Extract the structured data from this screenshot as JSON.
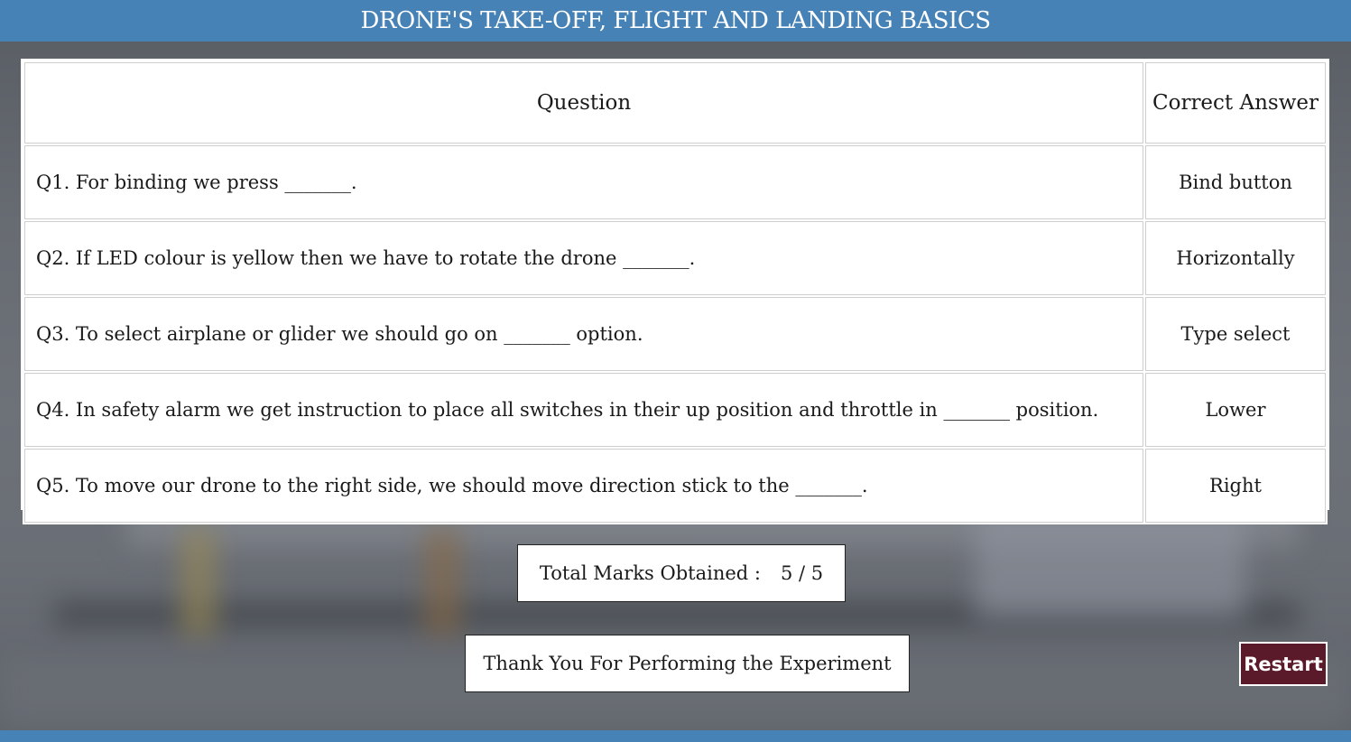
{
  "header": {
    "title": "DRONE'S TAKE-OFF, FLIGHT AND LANDING BASICS"
  },
  "table": {
    "columns": [
      "Question",
      "Correct Answer"
    ],
    "rows": [
      {
        "question": "Q1. For binding we press _______.",
        "answer": "Bind button"
      },
      {
        "question": "Q2. If LED colour is yellow then we have to rotate the drone _______.",
        "answer": "Horizontally"
      },
      {
        "question": "Q3. To select airplane or glider we should go on _______ option.",
        "answer": "Type select"
      },
      {
        "question": "Q4. In safety alarm we get instruction to place all switches in their up position and throttle in _______ position.",
        "answer": "Lower"
      },
      {
        "question": "Q5. To move our drone to the right side, we should move direction stick to the _______.",
        "answer": "Right"
      }
    ]
  },
  "result": {
    "marks_label": "Total Marks Obtained :",
    "marks_value": "5 / 5",
    "thanks_text": "Thank You For Performing the Experiment"
  },
  "controls": {
    "restart_label": "Restart"
  },
  "colors": {
    "header_bar": "#4682b6",
    "restart_bg": "#5a1a2a"
  }
}
